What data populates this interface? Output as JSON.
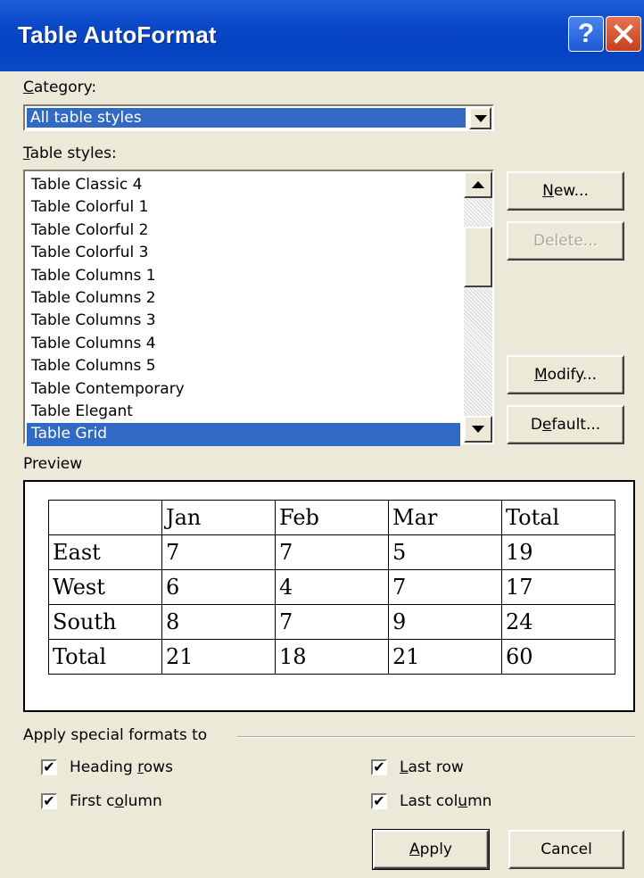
{
  "window": {
    "title": "Table AutoFormat",
    "help_label": "?",
    "close_icon": "close-x-icon",
    "titlebar_color": "#0a48c8"
  },
  "category": {
    "label_hotkey": "C",
    "label_rest": "ategory:",
    "selected": "All table styles"
  },
  "table_styles": {
    "label_hotkey": "T",
    "label_rest": "able styles:",
    "items": [
      "Table Classic 4",
      "Table Colorful 1",
      "Table Colorful 2",
      "Table Colorful 3",
      "Table Columns 1",
      "Table Columns 2",
      "Table Columns 3",
      "Table Columns 4",
      "Table Columns 5",
      "Table Contemporary",
      "Table Elegant",
      "Table Grid"
    ],
    "selected_index": 11,
    "selection_color": "#316ac5"
  },
  "buttons": {
    "new": {
      "hotkey": "N",
      "rest": "ew..."
    },
    "delete": {
      "pre": "Delete...",
      "enabled": false
    },
    "modify": {
      "hotkey": "M",
      "rest": "odify..."
    },
    "default": {
      "pre": "D",
      "hotkey": "e",
      "rest": "fault..."
    }
  },
  "preview": {
    "label": "Preview",
    "rows": [
      [
        "",
        "Jan",
        "Feb",
        "Mar",
        "Total"
      ],
      [
        "East",
        "7",
        "7",
        "5",
        "19"
      ],
      [
        "West",
        "6",
        "4",
        "7",
        "17"
      ],
      [
        "South",
        "8",
        "7",
        "9",
        "24"
      ],
      [
        "Total",
        "21",
        "18",
        "21",
        "60"
      ]
    ]
  },
  "special_formats": {
    "label": "Apply special formats to",
    "heading_rows": {
      "pre": "Heading ",
      "hotkey": "r",
      "rest": "ows",
      "checked": true
    },
    "first_column": {
      "pre": "First c",
      "hotkey": "o",
      "rest": "lumn",
      "checked": true
    },
    "last_row": {
      "pre": "",
      "hotkey": "L",
      "rest": "ast row",
      "checked": true
    },
    "last_column": {
      "pre": "Last col",
      "hotkey": "u",
      "rest": "mn",
      "checked": true
    },
    "check_mark": "✔"
  },
  "footer": {
    "apply": {
      "hotkey": "A",
      "rest": "pply"
    },
    "cancel": "Cancel"
  }
}
